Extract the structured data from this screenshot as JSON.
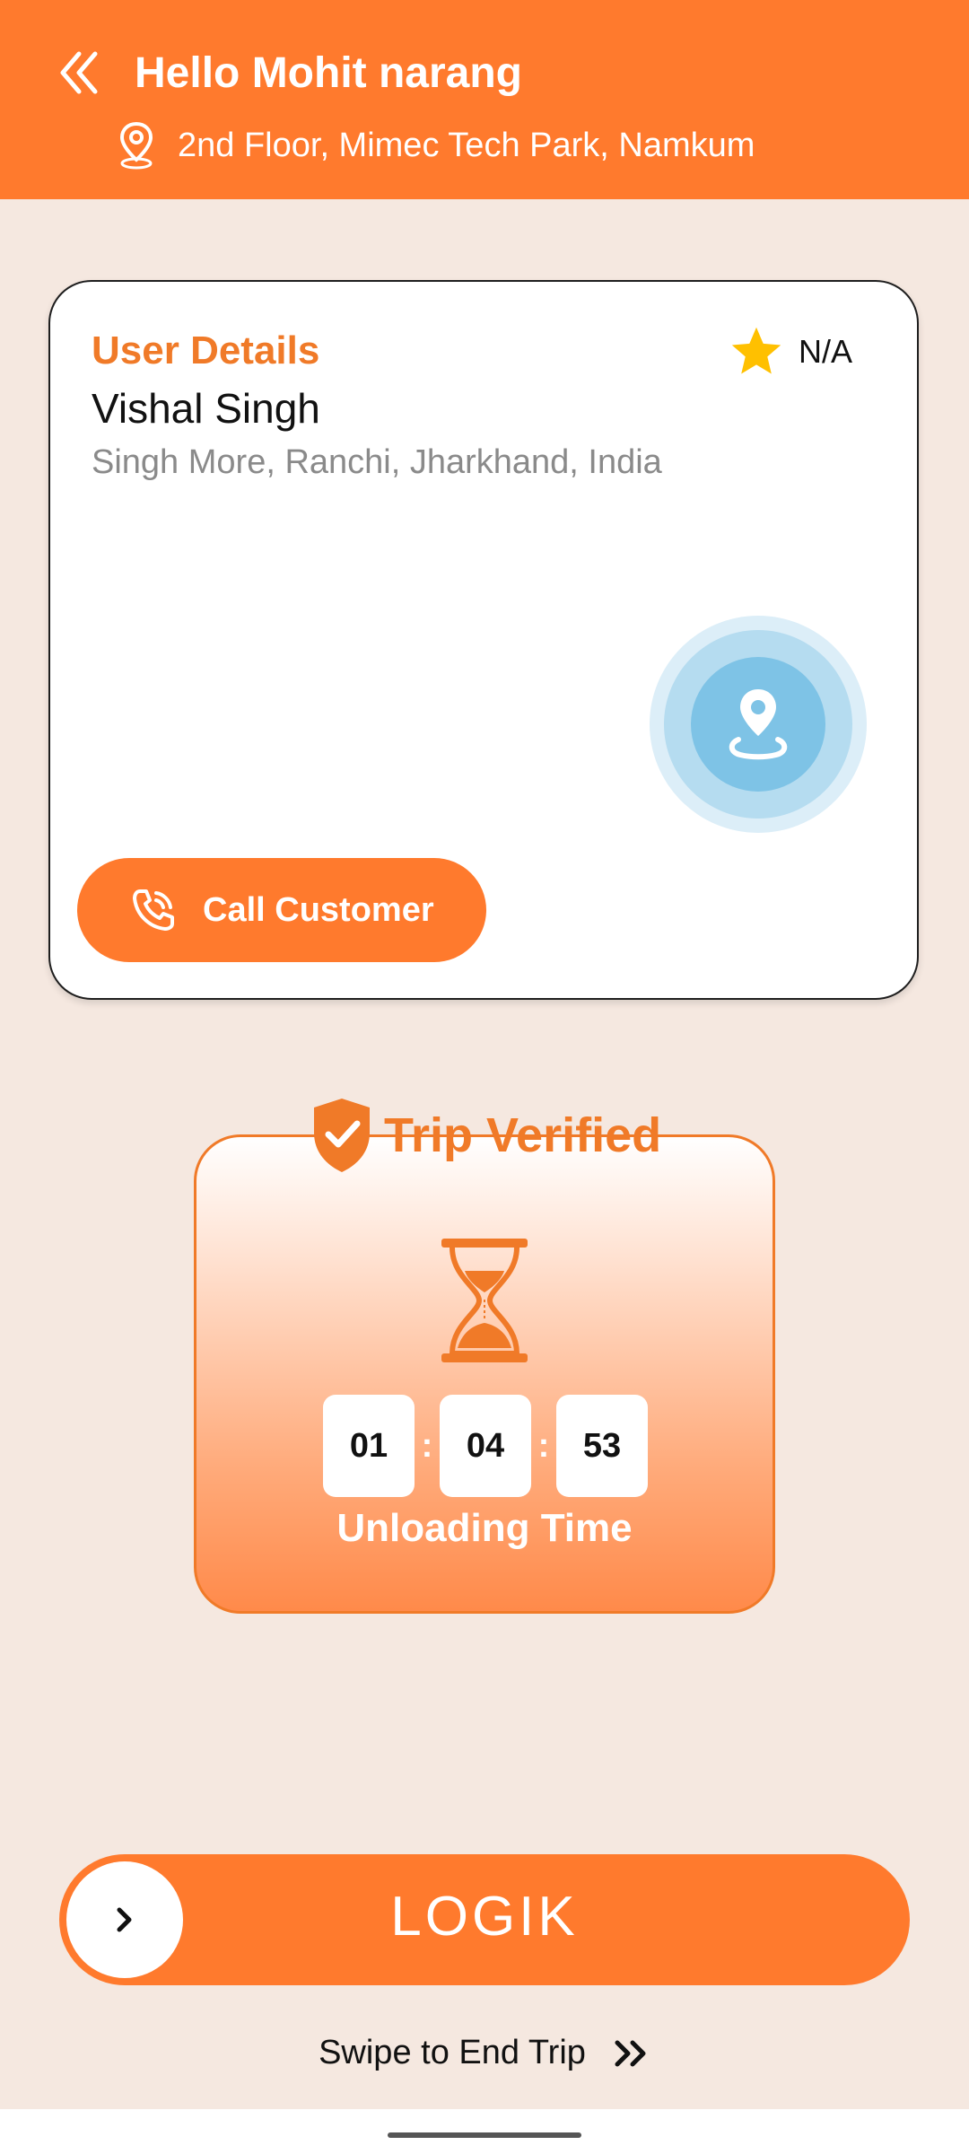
{
  "header": {
    "greeting": "Hello Mohit narang",
    "location": "2nd Floor, Mimec Tech Park, Namkum",
    "icons": {
      "back": "double-chevron-left-icon",
      "location": "location-pin-icon"
    }
  },
  "user_card": {
    "title": "User Details",
    "rating": "N/A",
    "name": "Vishal Singh",
    "address": "Singh More, Ranchi, Jharkhand, India",
    "call_label": "Call Customer",
    "icons": {
      "rating": "star-icon",
      "map": "map-pin-icon",
      "call": "phone-icon"
    }
  },
  "trip": {
    "status": "Trip Verified",
    "timer": {
      "hours": "01",
      "minutes": "04",
      "seconds": "53"
    },
    "timer_label": "Unloading Time",
    "icons": {
      "status": "shield-check-icon",
      "timer": "hourglass-icon"
    }
  },
  "swipe": {
    "brand": "LOGIK",
    "hint": "Swipe to End Trip",
    "icons": {
      "knob": "chevron-right-icon",
      "hint": "double-chevron-right-icon"
    }
  },
  "colors": {
    "primary": "#FF7A2D",
    "accent_text": "#F07A28",
    "background": "#F5E8E0",
    "star": "#FFC000",
    "map_blue": "#7EC3E6"
  }
}
